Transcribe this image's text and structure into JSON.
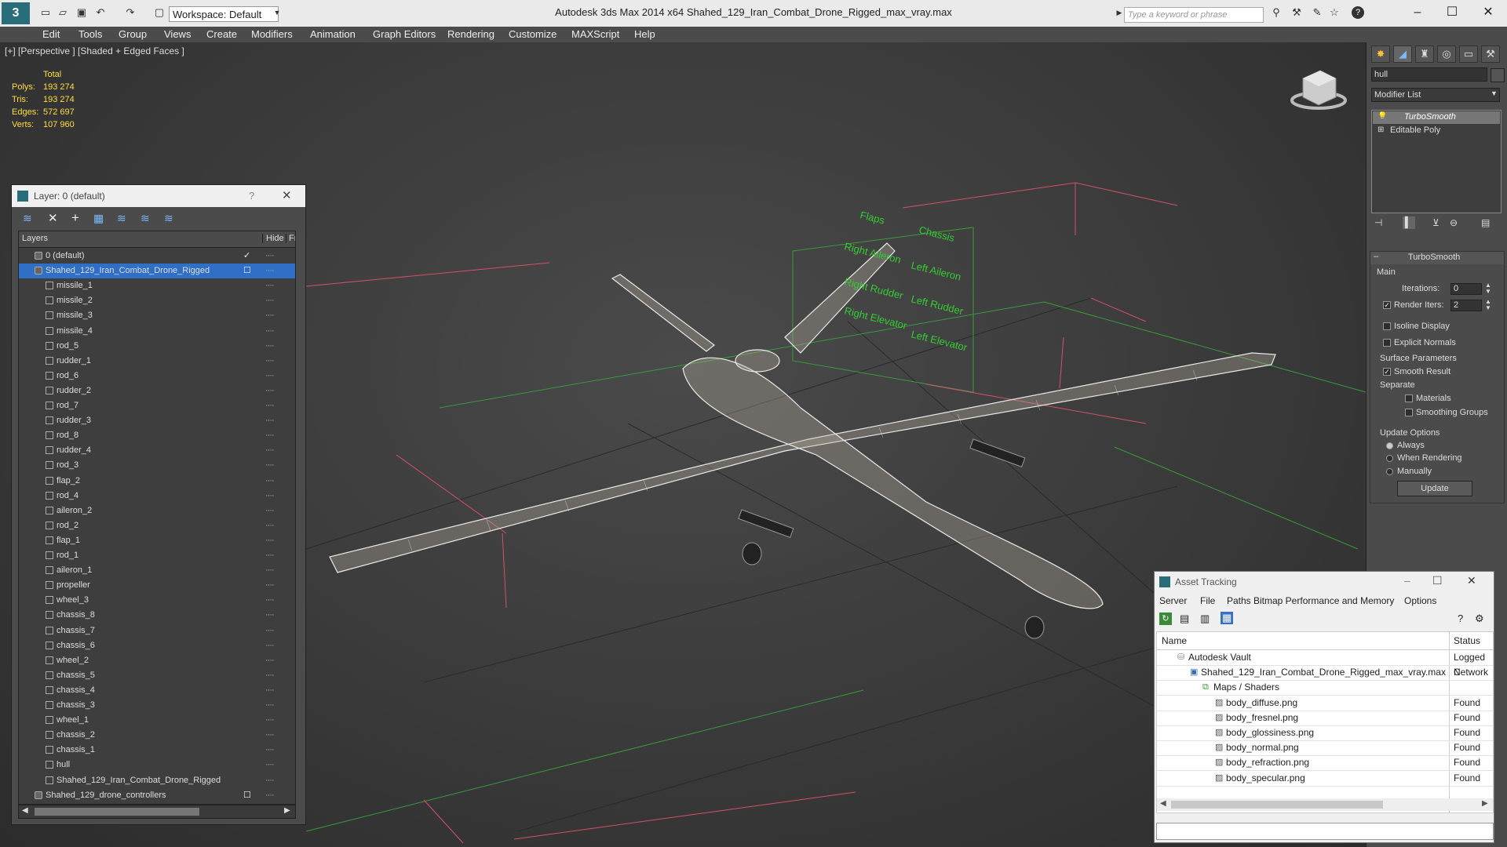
{
  "app": {
    "title": "Autodesk 3ds Max  2014 x64     Shahed_129_Iran_Combat_Drone_Rigged_max_vray.max",
    "workspace": "Workspace: Default",
    "search_placeholder": "Type a keyword or phrase"
  },
  "menu": [
    "Edit",
    "Tools",
    "Group",
    "Views",
    "Create",
    "Modifiers",
    "Animation",
    "Graph Editors",
    "Rendering",
    "Customize",
    "MAXScript",
    "Help"
  ],
  "viewport": {
    "label": "[+] [Perspective ] [Shaded + Edged Faces ]",
    "stats": {
      "total": "Total",
      "polys_label": "Polys:",
      "polys": "193 274",
      "tris_label": "Tris:",
      "tris": "193 274",
      "edges_label": "Edges:",
      "edges": "572 697",
      "verts_label": "Verts:",
      "verts": "107 960"
    },
    "rig_labels": [
      "Flaps",
      "Right Aileron",
      "Right Rudder",
      "Right Elevator",
      "Chassis",
      "Left Aileron",
      "Left Rudder",
      "Left Elevator"
    ]
  },
  "layer_window": {
    "title": "Layer: 0 (default)",
    "help": "?",
    "col_layers": "Layers",
    "col_hide": "Hide",
    "col_freeze": "Fr",
    "rows": [
      {
        "name": "0 (default)",
        "level": 0,
        "type": "layer"
      },
      {
        "name": "Shahed_129_Iran_Combat_Drone_Rigged",
        "level": 0,
        "type": "layer",
        "selected": true
      },
      {
        "name": "missile_1",
        "level": 1,
        "type": "obj"
      },
      {
        "name": "missile_2",
        "level": 1,
        "type": "obj"
      },
      {
        "name": "missile_3",
        "level": 1,
        "type": "obj"
      },
      {
        "name": "missile_4",
        "level": 1,
        "type": "obj"
      },
      {
        "name": "rod_5",
        "level": 1,
        "type": "obj"
      },
      {
        "name": "rudder_1",
        "level": 1,
        "type": "obj"
      },
      {
        "name": "rod_6",
        "level": 1,
        "type": "obj"
      },
      {
        "name": "rudder_2",
        "level": 1,
        "type": "obj"
      },
      {
        "name": "rod_7",
        "level": 1,
        "type": "obj"
      },
      {
        "name": "rudder_3",
        "level": 1,
        "type": "obj"
      },
      {
        "name": "rod_8",
        "level": 1,
        "type": "obj"
      },
      {
        "name": "rudder_4",
        "level": 1,
        "type": "obj"
      },
      {
        "name": "rod_3",
        "level": 1,
        "type": "obj"
      },
      {
        "name": "flap_2",
        "level": 1,
        "type": "obj"
      },
      {
        "name": "rod_4",
        "level": 1,
        "type": "obj"
      },
      {
        "name": "aileron_2",
        "level": 1,
        "type": "obj"
      },
      {
        "name": "rod_2",
        "level": 1,
        "type": "obj"
      },
      {
        "name": "flap_1",
        "level": 1,
        "type": "obj"
      },
      {
        "name": "rod_1",
        "level": 1,
        "type": "obj"
      },
      {
        "name": "aileron_1",
        "level": 1,
        "type": "obj"
      },
      {
        "name": "propeller",
        "level": 1,
        "type": "obj"
      },
      {
        "name": "wheel_3",
        "level": 1,
        "type": "obj"
      },
      {
        "name": "chassis_8",
        "level": 1,
        "type": "obj"
      },
      {
        "name": "chassis_7",
        "level": 1,
        "type": "obj"
      },
      {
        "name": "chassis_6",
        "level": 1,
        "type": "obj"
      },
      {
        "name": "wheel_2",
        "level": 1,
        "type": "obj"
      },
      {
        "name": "chassis_5",
        "level": 1,
        "type": "obj"
      },
      {
        "name": "chassis_4",
        "level": 1,
        "type": "obj"
      },
      {
        "name": "chassis_3",
        "level": 1,
        "type": "obj"
      },
      {
        "name": "wheel_1",
        "level": 1,
        "type": "obj"
      },
      {
        "name": "chassis_2",
        "level": 1,
        "type": "obj"
      },
      {
        "name": "chassis_1",
        "level": 1,
        "type": "obj"
      },
      {
        "name": "hull",
        "level": 1,
        "type": "obj"
      },
      {
        "name": "Shahed_129_Iran_Combat_Drone_Rigged",
        "level": 1,
        "type": "obj"
      },
      {
        "name": "Shahed_129_drone_controllers",
        "level": 0,
        "type": "layer"
      }
    ]
  },
  "command_panel": {
    "object_name": "hull",
    "modifier_list": "Modifier List",
    "stack": [
      "TurboSmooth",
      "Editable Poly"
    ],
    "rollout_title": "TurboSmooth",
    "main_label": "Main",
    "iterations_label": "Iterations:",
    "iterations": "0",
    "render_iters_label": "Render Iters:",
    "render_iters": "2",
    "isoline": "Isoline Display",
    "explicit_normals": "Explicit Normals",
    "surface_params": "Surface Parameters",
    "smooth_result": "Smooth Result",
    "separate": "Separate",
    "materials": "Materials",
    "smoothing_groups": "Smoothing Groups",
    "update_options": "Update Options",
    "always": "Always",
    "when_rendering": "When Rendering",
    "manually": "Manually",
    "update_btn": "Update"
  },
  "asset_window": {
    "title": "Asset Tracking",
    "menu": [
      "Server",
      "File",
      "Paths",
      "Bitmap Performance and Memory",
      "Options"
    ],
    "col_name": "Name",
    "col_status": "Status",
    "rows": [
      {
        "name": "Autodesk Vault",
        "level": 1,
        "status": "Logged C"
      },
      {
        "name": "Shahed_129_Iran_Combat_Drone_Rigged_max_vray.max",
        "level": 2,
        "status": "Network"
      },
      {
        "name": "Maps / Shaders",
        "level": 3,
        "status": ""
      },
      {
        "name": "body_diffuse.png",
        "level": 4,
        "status": "Found"
      },
      {
        "name": "body_fresnel.png",
        "level": 4,
        "status": "Found"
      },
      {
        "name": "body_glossiness.png",
        "level": 4,
        "status": "Found"
      },
      {
        "name": "body_normal.png",
        "level": 4,
        "status": "Found"
      },
      {
        "name": "body_refraction.png",
        "level": 4,
        "status": "Found"
      },
      {
        "name": "body_specular.png",
        "level": 4,
        "status": "Found"
      }
    ]
  }
}
